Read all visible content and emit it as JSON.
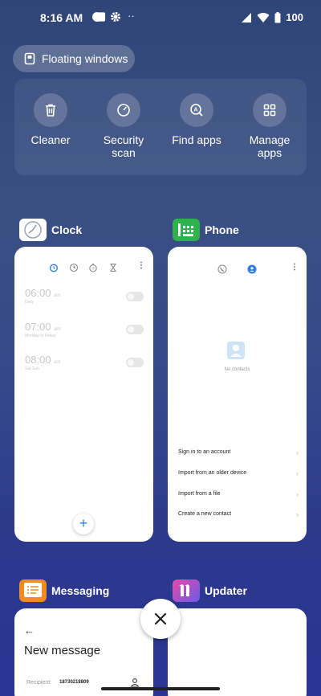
{
  "status_bar": {
    "time": "8:16 AM",
    "battery": "100"
  },
  "floating_windows": {
    "label": "Floating windows"
  },
  "tools": [
    {
      "label": "Cleaner",
      "icon": "trash-icon"
    },
    {
      "label": "Security scan",
      "icon": "speedometer-icon"
    },
    {
      "label": "Find apps",
      "icon": "app-search-icon"
    },
    {
      "label": "Manage apps",
      "icon": "grid-icon"
    }
  ],
  "apps": {
    "clock": {
      "name": "Clock",
      "alarms": [
        {
          "time": "06:00",
          "ampm": "am",
          "sub": "Daily"
        },
        {
          "time": "07:00",
          "ampm": "am",
          "sub": "Monday to Friday"
        },
        {
          "time": "08:00",
          "ampm": "am",
          "sub": "Sat Sun"
        }
      ],
      "fab": "+"
    },
    "phone": {
      "name": "Phone",
      "empty_text": "No contacts",
      "items": [
        "Sign in to an account",
        "Import from an older device",
        "Import from a file",
        "Create a new contact"
      ]
    },
    "messaging": {
      "name": "Messaging",
      "title": "New message",
      "recipient_label": "Recipient:",
      "recipient_value": "18730218809"
    },
    "updater": {
      "name": "Updater"
    }
  },
  "colors": {
    "accent_blue": "#2f7ee0",
    "phone_green": "#2db34a",
    "messaging_orange": "#f08a24"
  }
}
